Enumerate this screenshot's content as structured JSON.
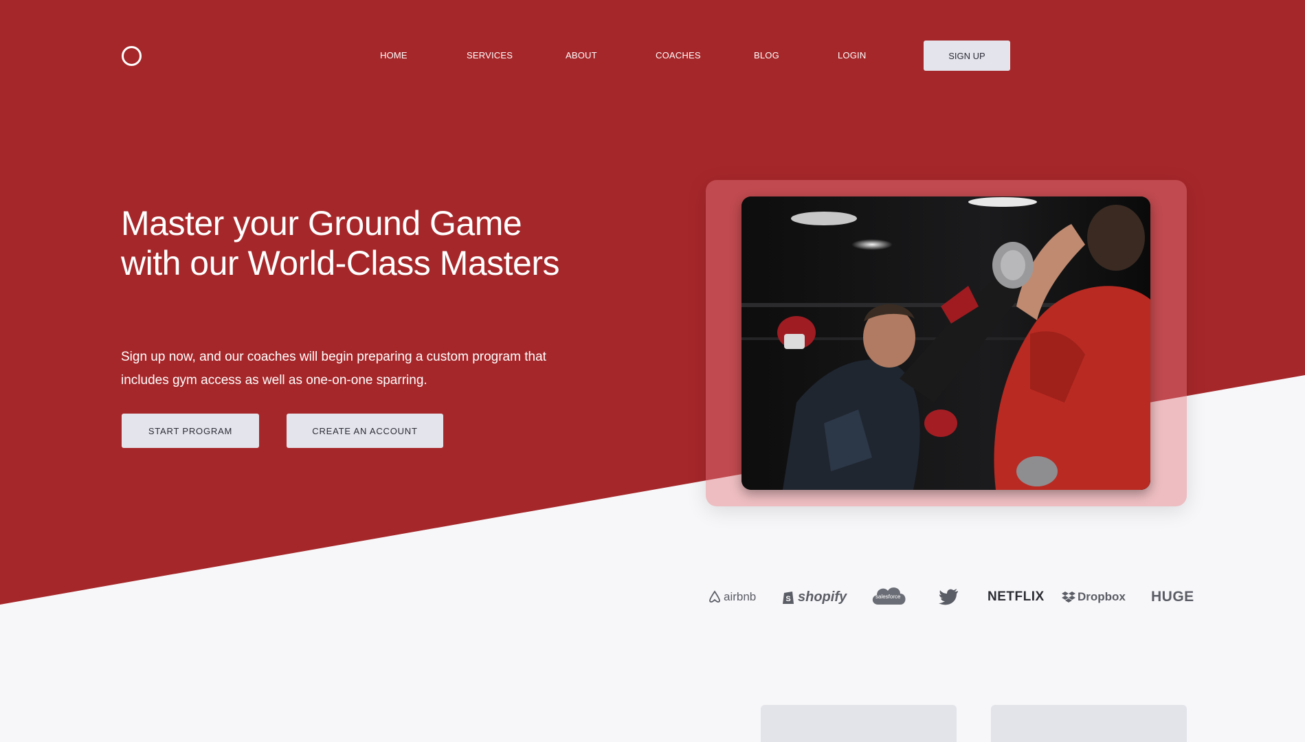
{
  "nav": {
    "links": [
      "HOME",
      "SERVICES",
      "ABOUT",
      "COACHES",
      "BLOG",
      "LOGIN"
    ],
    "signup": "SIGN UP"
  },
  "hero": {
    "title": "Master your Ground Game with our World-Class Masters",
    "subtitle": "Sign up now, and our coaches will begin preparing a custom program that includes gym access as well as one-on-one sparring.",
    "primary_button": "START PROGRAM",
    "secondary_button": "CREATE AN ACCOUNT"
  },
  "logos": {
    "airbnb": "airbnb",
    "shopify": "shopify",
    "salesforce": "salesforce",
    "netflix": "NETFLIX",
    "dropbox": "Dropbox",
    "huge": "HUGE"
  },
  "colors": {
    "hero_red": "#a6272a",
    "page_bg": "#f7f7f9",
    "button_bg": "#e4e5ec"
  },
  "icons": [
    "circle-logo-icon",
    "airbnb-logo-icon",
    "shopify-logo-icon",
    "salesforce-logo-icon",
    "twitter-bird-icon",
    "dropbox-logo-icon"
  ]
}
